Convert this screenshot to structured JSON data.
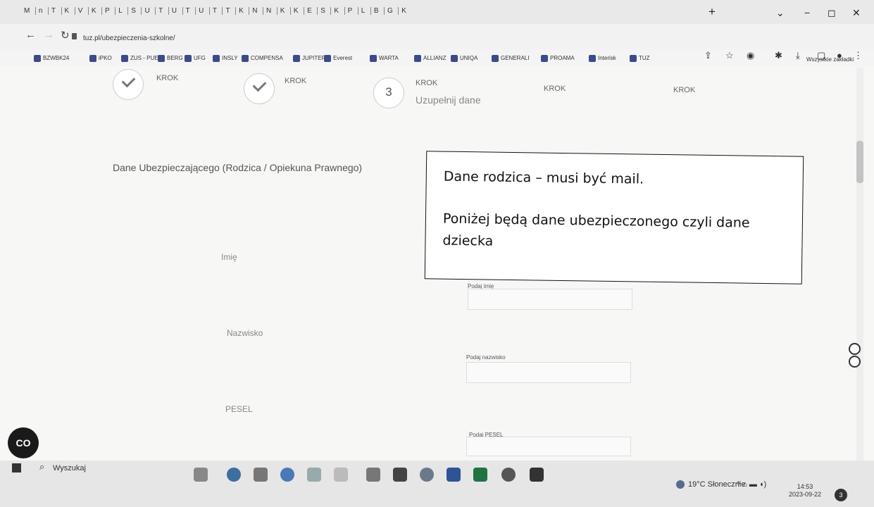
{
  "browser": {
    "tabs": [
      "M",
      "n",
      "T",
      "K",
      "V",
      "K",
      "P",
      "L",
      "S",
      "U",
      "T",
      "U",
      "T",
      "U",
      "T",
      "T",
      "K",
      "N",
      "N",
      "K",
      "K",
      "E",
      "S",
      "K",
      "P",
      "L",
      "B",
      "G",
      "K"
    ],
    "url": "tuz.pl/ubezpieczenia-szkolne/",
    "bookmarks": [
      "BZWBK24",
      "iPKO",
      "ZUS - PUE",
      "BERG",
      "UFG",
      "INSLY",
      "COMPENSA",
      "JUPITER",
      "Everest",
      "WARTA",
      "ALLIANZ",
      "UNIQA",
      "GENERALI",
      "PROAMA",
      "Interisk",
      "TUZ"
    ],
    "all_bookmarks_label": "Wszystkie zakładki"
  },
  "steps": [
    {
      "label": "KROK",
      "status": "done"
    },
    {
      "label": "KROK",
      "status": "done"
    },
    {
      "label": "KROK",
      "number": "3",
      "subtitle": "Uzupełnij dane",
      "status": "current"
    },
    {
      "label": "KROK",
      "status": "upcoming"
    },
    {
      "label": "KROK",
      "status": "upcoming"
    }
  ],
  "form": {
    "section_title": "Dane Ubezpieczającego (Rodzica / Opiekuna Prawnego)",
    "fields": [
      {
        "label": "Imię",
        "input_label": "Podaj imię"
      },
      {
        "label": "Nazwisko",
        "input_label": "Podaj nazwisko"
      },
      {
        "label": "PESEL",
        "input_label": "Podaj PESEL"
      }
    ]
  },
  "callout": {
    "line1": "Dane rodzica – musi być mail.",
    "line2": "Poniżej będą dane ubezpieczonego czyli dane dziecka"
  },
  "fab_label": "CO",
  "taskbar": {
    "search_label": "Wyszukaj",
    "weather": "19°C Słonecznie",
    "time": "14:53",
    "date": "2023-09-22",
    "notifications": "3"
  }
}
